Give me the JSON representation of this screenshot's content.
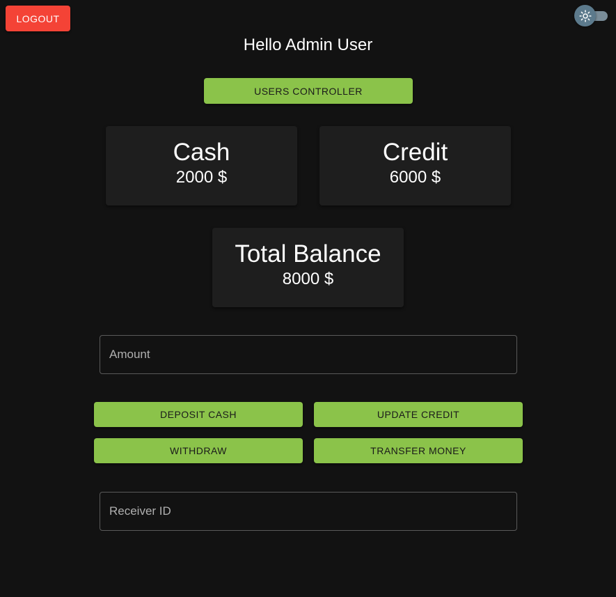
{
  "header": {
    "logout_label": "LOGOUT",
    "theme_toggle_icon": "sun-icon",
    "greeting": "Hello Admin User"
  },
  "nav": {
    "users_controller_label": "USERS CONTROLLER"
  },
  "balances": {
    "cash": {
      "title": "Cash",
      "value": "2000 $"
    },
    "credit": {
      "title": "Credit",
      "value": "6000 $"
    },
    "total": {
      "title": "Total Balance",
      "value": "8000 $"
    }
  },
  "form": {
    "amount_placeholder": "Amount",
    "receiver_placeholder": "Receiver ID"
  },
  "actions": {
    "deposit_label": "DEPOSIT CASH",
    "update_credit_label": "UPDATE CREDIT",
    "withdraw_label": "WITHDRAW",
    "transfer_label": "TRANSFER MONEY"
  },
  "colors": {
    "background": "#121212",
    "card": "#1e1e1e",
    "primary_green": "#8bc34a",
    "logout_red": "#f44336"
  }
}
